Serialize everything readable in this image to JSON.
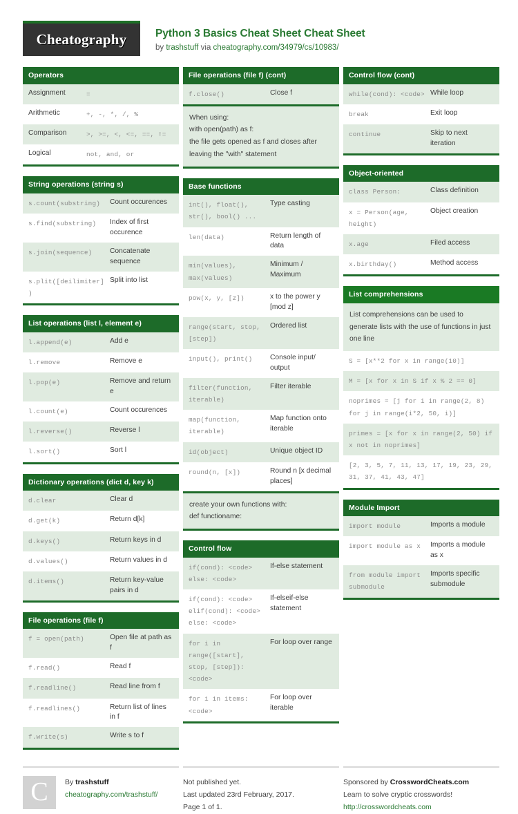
{
  "header": {
    "logo": "Cheatography",
    "title": "Python 3 Basics Cheat Sheet Cheat Sheet",
    "byline_prefix": "by ",
    "author": "trashstuff",
    "byline_mid": " via ",
    "source_url": "cheatography.com/34979/cs/10983/"
  },
  "colors": {
    "header_green": "#1d6b29",
    "bright_green": "#1a7a24",
    "row_alt": "#e0ebe0",
    "link_green": "#2a7a33",
    "logo_bg": "#333333"
  },
  "columns": [
    {
      "blocks": [
        {
          "title": "Operators",
          "rows": [
            {
              "code": "Assignment",
              "desc": "=",
              "swap": true
            },
            {
              "code": "Arithmetic",
              "desc": "+, -, *, /, %",
              "swap": true
            },
            {
              "code": "Comparison",
              "desc": ">, >=, <, <=, ==, !=",
              "swap": true
            },
            {
              "code": "Logical",
              "desc": "not, and, or",
              "swap": true
            }
          ]
        },
        {
          "title": "String operations (string s)",
          "rows": [
            {
              "code": "s.count(substring)",
              "desc": "Count occurences"
            },
            {
              "code": "s.find(substring)",
              "desc": "Index of first occurence"
            },
            {
              "code": "s.join(sequence)",
              "desc": "Concatenate sequence"
            },
            {
              "code": "s.plit([deilimiter])",
              "desc": "Split into list"
            }
          ]
        },
        {
          "title": "List operations (list l, element e)",
          "rows": [
            {
              "code": "l.append(e)",
              "desc": "Add e"
            },
            {
              "code": "l.remove",
              "desc": "Remove e"
            },
            {
              "code": "l.pop(e)",
              "desc": "Remove and return e"
            },
            {
              "code": "l.count(e)",
              "desc": "Count occurences"
            },
            {
              "code": "l.reverse()",
              "desc": "Reverse l"
            },
            {
              "code": "l.sort()",
              "desc": "Sort l"
            }
          ]
        },
        {
          "title": "Dictionary operations (dict d, key k)",
          "rows": [
            {
              "code": "d.clear",
              "desc": "Clear d"
            },
            {
              "code": "d.get(k)",
              "desc": "Return d[k]"
            },
            {
              "code": "d.keys()",
              "desc": "Return keys in d"
            },
            {
              "code": "d.values()",
              "desc": "Return values in d"
            },
            {
              "code": "d.items()",
              "desc": "Return key-value pairs in d"
            }
          ]
        },
        {
          "title": "File operations (file f)",
          "rows": [
            {
              "code": "f = open(path)",
              "desc": "Open file at path as f"
            },
            {
              "code": "f.read()",
              "desc": "Read f"
            },
            {
              "code": "f.readline()",
              "desc": "Read line from f"
            },
            {
              "code": "f.readlines()",
              "desc": "Return list of lines in f"
            },
            {
              "code": "f.write(s)",
              "desc": "Write s to f"
            }
          ]
        }
      ]
    },
    {
      "blocks": [
        {
          "title": "File operations (file f) (cont)",
          "rows": [
            {
              "code": "f.close()",
              "desc": "Close f"
            }
          ],
          "notes": [
            {
              "text": "When using:\nwith open(path) as f:\nthe file gets opened as f and closes after leaving the \"with\" statement",
              "alt": true
            }
          ]
        },
        {
          "title": "Base functions",
          "rows": [
            {
              "code": "int(), float(), str(), bool() ...",
              "desc": "Type casting"
            },
            {
              "code": "len(data)",
              "desc": "Return length of data"
            },
            {
              "code": "min(values), max(values)",
              "desc": "Minimum / Maximum"
            },
            {
              "code": "pow(x, y, [z])",
              "desc": "x to the power y [mod z]"
            },
            {
              "code": "range(start, stop, [step])",
              "desc": "Ordered list"
            },
            {
              "code": "input(), print()",
              "desc": "Console input/ output"
            },
            {
              "code": "filter(function, iterable)",
              "desc": "Filter iterable"
            },
            {
              "code": "map(function, iterable)",
              "desc": "Map function onto iterable"
            },
            {
              "code": "id(object)",
              "desc": "Unique object ID"
            },
            {
              "code": "round(n, [x])",
              "desc": "Round n [x decimal places]"
            }
          ],
          "notes": [
            {
              "text": "create your own functions with:\ndef functioname:",
              "alt": true
            }
          ]
        },
        {
          "title": "Control flow",
          "rows": [
            {
              "code": "if(cond): <code> else: <code>",
              "desc": "If-else statement"
            },
            {
              "code": "if(cond): <code> elif(cond): <code> else: <code>",
              "desc": "If-elseif-else statement"
            },
            {
              "code": "for i in range([start], stop, [step]): <code>",
              "desc": "For loop over range"
            },
            {
              "code": "for i in items: <code>",
              "desc": "For loop over iterable"
            }
          ]
        }
      ]
    },
    {
      "blocks": [
        {
          "title": "Control flow (cont)",
          "rows": [
            {
              "code": "while(cond): <code>",
              "desc": "While loop"
            },
            {
              "code": "break",
              "desc": "Exit loop"
            },
            {
              "code": "continue",
              "desc": "Skip to next iteration"
            }
          ]
        },
        {
          "title": "Object-oriented",
          "rows": [
            {
              "code": "class Person:",
              "desc": "Class definition"
            },
            {
              "code": "x = Person(age, height)",
              "desc": "Object creation"
            },
            {
              "code": "x.age",
              "desc": "Filed access"
            },
            {
              "code": "x.birthday()",
              "desc": "Method access"
            }
          ]
        },
        {
          "title": "List comprehensions",
          "bright": true,
          "notes": [
            {
              "text": "List comprehensions can be used to generate lists with the use of functions in just one line",
              "alt": true
            }
          ],
          "codelines": [
            {
              "text": "S = [x**2 for x in range(10)]",
              "alt": false
            },
            {
              "text": "M = [x for x in S if x % 2 == 0]",
              "alt": true
            },
            {
              "text": "noprimes = [j for i in range(2, 8) for j in range(i*2, 50, i)]",
              "alt": false
            },
            {
              "text": "primes = [x for x in range(2, 50) if x not in noprimes]",
              "alt": true
            },
            {
              "text": "[2, 3, 5, 7, 11, 13, 17, 19, 23, 29, 31, 37, 41, 43, 47]",
              "alt": false
            }
          ]
        },
        {
          "title": "Module Import",
          "rows": [
            {
              "code": "import module",
              "desc": "Imports a module"
            },
            {
              "code": "import module as x",
              "desc": "Imports a module as x"
            },
            {
              "code": "from module import submodule",
              "desc": "Imports specific submodule"
            }
          ]
        }
      ]
    }
  ],
  "footer": {
    "avatar_letter": "C",
    "by_label": "By ",
    "author": "trashstuff",
    "author_url": "cheatography.com/trashstuff/",
    "publish_status": "Not published yet.",
    "last_updated": "Last updated 23rd February, 2017.",
    "page_info": "Page 1 of 1.",
    "sponsor_label": "Sponsored by ",
    "sponsor_name": "CrosswordCheats.com",
    "sponsor_tagline": "Learn to solve cryptic crosswords!",
    "sponsor_url": "http://crosswordcheats.com"
  }
}
